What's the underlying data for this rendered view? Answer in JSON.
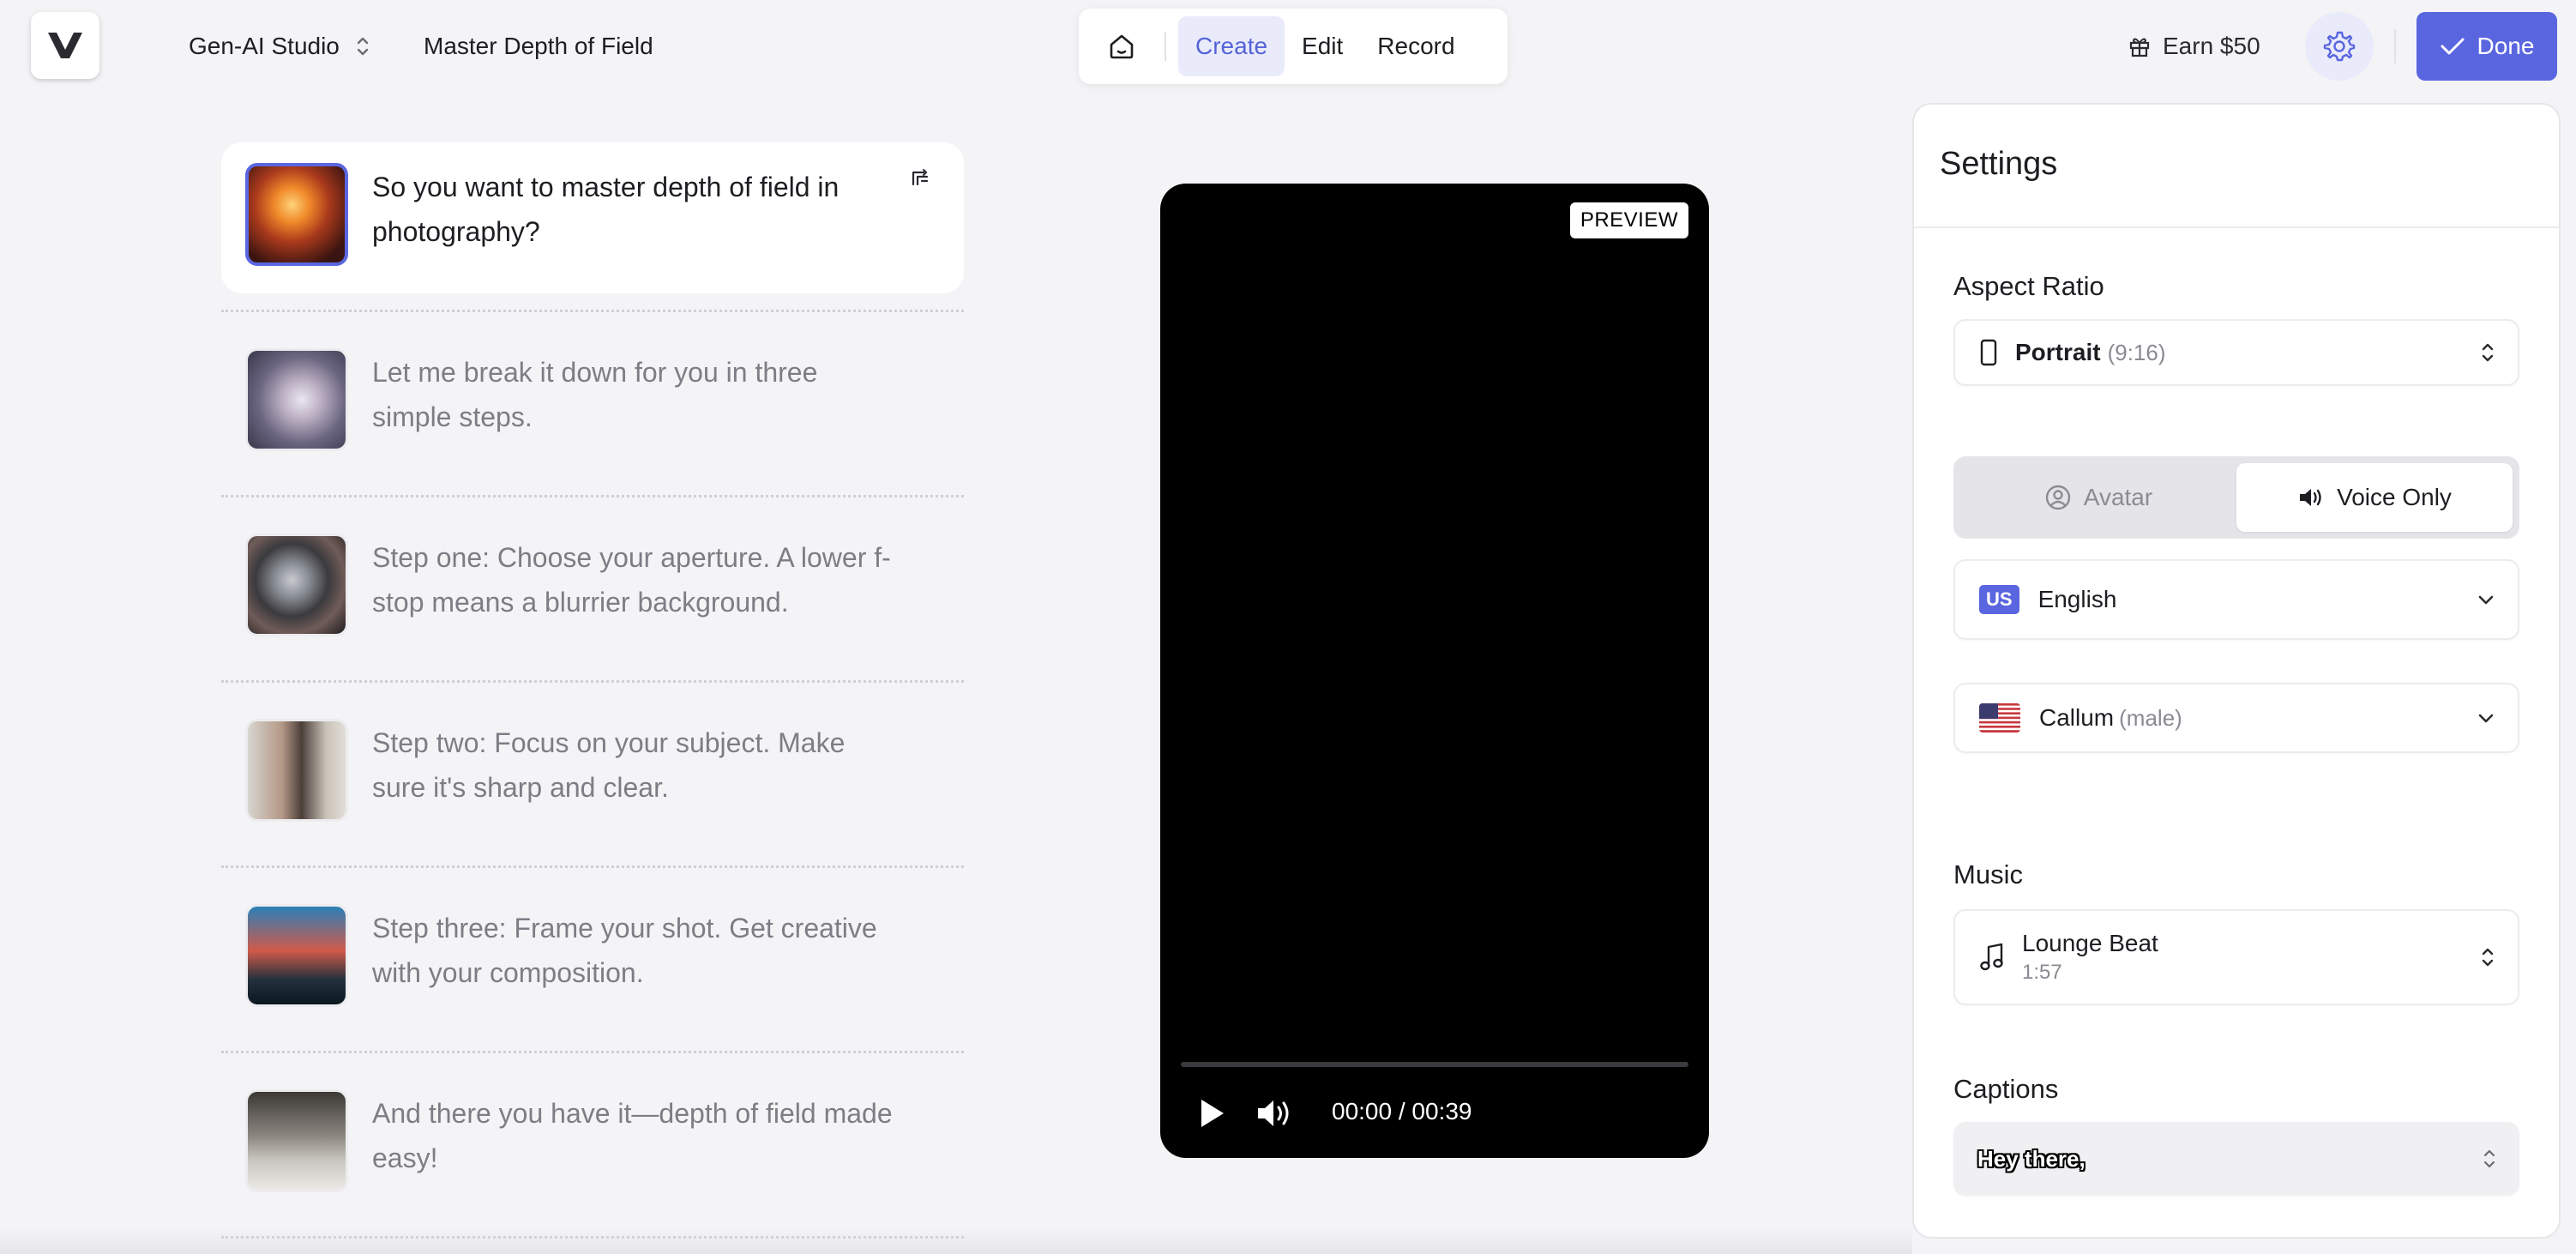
{
  "header": {
    "workspace_name": "Gen-AI Studio",
    "project_title": "Master Depth of Field",
    "tabs": [
      {
        "label": "Create",
        "active": true
      },
      {
        "label": "Edit",
        "active": false
      },
      {
        "label": "Record",
        "active": false
      }
    ],
    "earn_label": "Earn $50",
    "done_label": "Done"
  },
  "scenes": [
    {
      "text": "So you want to master depth of field in photography?",
      "active": true
    },
    {
      "text": "Let me break it down for you in three simple steps.",
      "active": false
    },
    {
      "text": "Step one: Choose your aperture. A lower f-stop means a blurrier background.",
      "active": false
    },
    {
      "text": "Step two: Focus on your subject. Make sure it's sharp and clear.",
      "active": false
    },
    {
      "text": "Step three: Frame your shot. Get creative with your composition.",
      "active": false
    },
    {
      "text": "And there you have it—depth of field made easy!",
      "active": false
    }
  ],
  "preview": {
    "badge": "PREVIEW",
    "time": "00:00 / 00:39",
    "progress": 0
  },
  "settings": {
    "title": "Settings",
    "aspect_ratio": {
      "title": "Aspect Ratio",
      "value": "Portrait",
      "detail": "(9:16)"
    },
    "mode_toggle": {
      "options": [
        {
          "label": "Avatar",
          "icon": "user-circle-icon",
          "active": false
        },
        {
          "label": "Voice Only",
          "icon": "speaker-icon",
          "active": true
        }
      ]
    },
    "language": {
      "badge": "US",
      "value": "English"
    },
    "voice": {
      "name": "Callum",
      "detail": "(male)",
      "flag": "us-flag-icon"
    },
    "music": {
      "title": "Music",
      "track": "Lounge Beat",
      "duration": "1:57"
    },
    "captions": {
      "title": "Captions",
      "sample": "Hey there,"
    }
  },
  "colors": {
    "accent": "#5a66e0",
    "active_tab_bg": "#e9ebfb",
    "page_bg": "#f4f4f6"
  }
}
